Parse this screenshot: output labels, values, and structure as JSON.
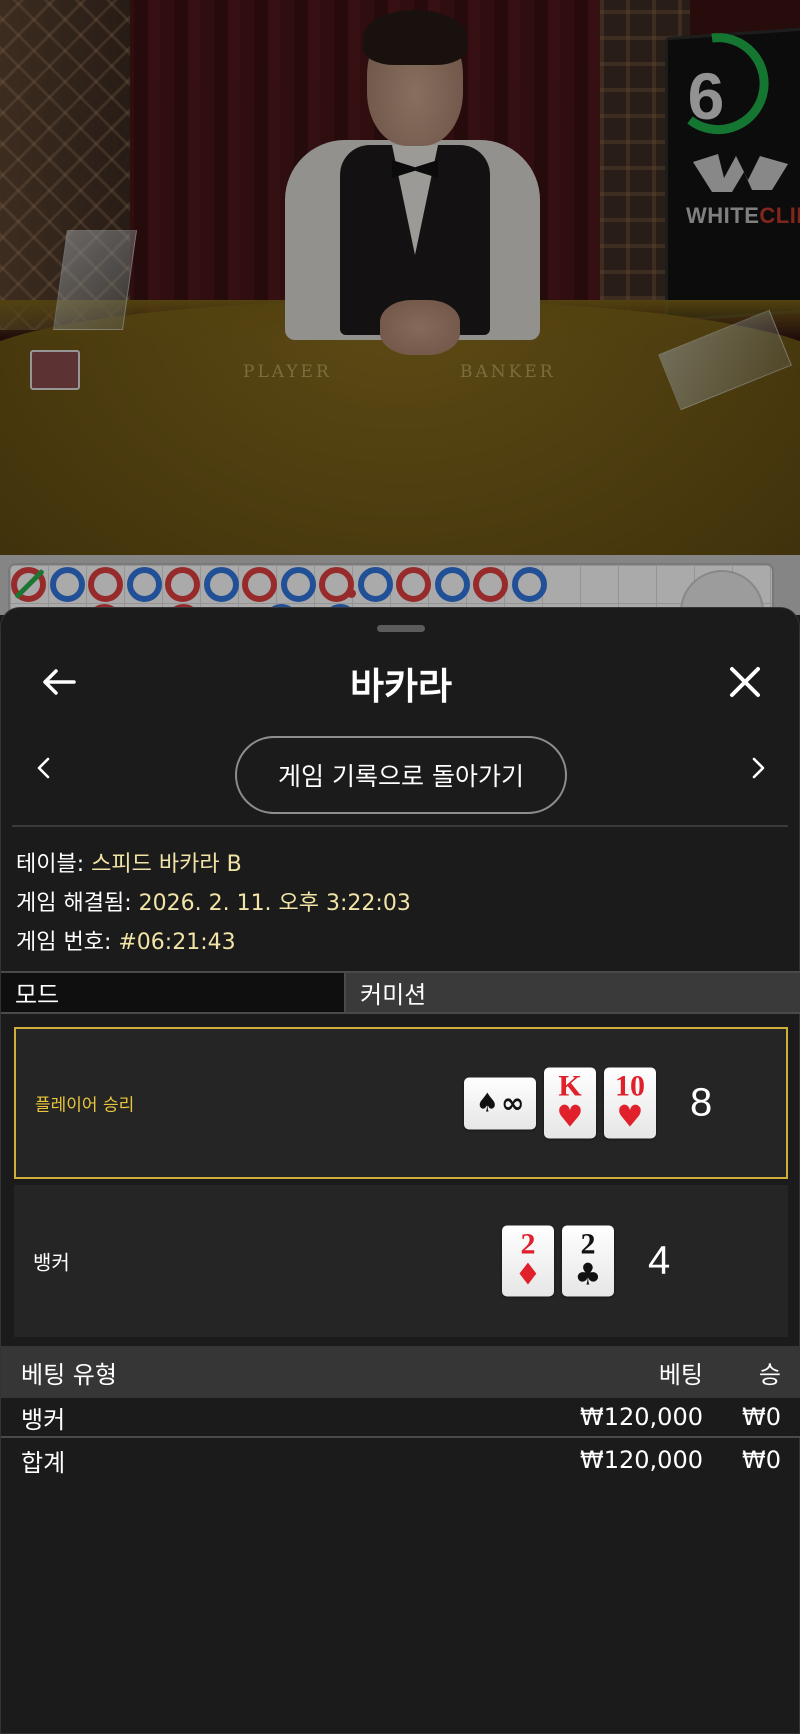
{
  "stream": {
    "timer": "6",
    "brand": {
      "prefix": "WHITE",
      "accent": "CLIFF"
    },
    "felt_labels": {
      "player": "PLAYER",
      "banker": "BANKER"
    }
  },
  "roadmap": {
    "row1": [
      "B-tie",
      "P",
      "B",
      "P",
      "B",
      "P",
      "B",
      "P",
      "B-pair",
      "P",
      "B",
      "P",
      "B",
      "P"
    ]
  },
  "sheet": {
    "title": "바카라",
    "return_button": "게임 기록으로 돌아가기",
    "info": {
      "table_label": "테이블: ",
      "table_value": "스피드 바카라 B",
      "resolved_label": "게임 해결됨: ",
      "resolved_value": "2026. 2. 11. 오후 3:22:03",
      "number_label": "게임 번호: ",
      "number_value": "#06:21:43"
    },
    "tabs": {
      "mode": "모드",
      "commission": "커미션"
    },
    "player": {
      "label": "플레이어 승리",
      "cards": [
        {
          "rank": "∞",
          "suit": "♠",
          "color": "black",
          "sideways": true
        },
        {
          "rank": "K",
          "suit": "♥",
          "color": "red"
        },
        {
          "rank": "10",
          "suit": "♥",
          "color": "red"
        }
      ],
      "total": "8"
    },
    "banker": {
      "label": "뱅커",
      "cards": [
        {
          "rank": "2",
          "suit": "♦",
          "color": "red"
        },
        {
          "rank": "2",
          "suit": "♣",
          "color": "black"
        }
      ],
      "total": "4"
    },
    "bets": {
      "headers": {
        "type": "베팅 유형",
        "bet": "베팅",
        "win": "승"
      },
      "rows": [
        {
          "type": "뱅커",
          "bet": "₩120,000",
          "win": "₩0"
        },
        {
          "type": "합계",
          "bet": "₩120,000",
          "win": "₩0"
        }
      ]
    }
  },
  "colors": {
    "winner_border": "#cfae3a",
    "winner_label": "#e9c63c",
    "info_value": "#f1e4a6",
    "bead_player": "#2f6fd1",
    "bead_banker": "#d23c3c",
    "bead_tie": "#27a244",
    "timer_ring": "#1fae4b"
  }
}
